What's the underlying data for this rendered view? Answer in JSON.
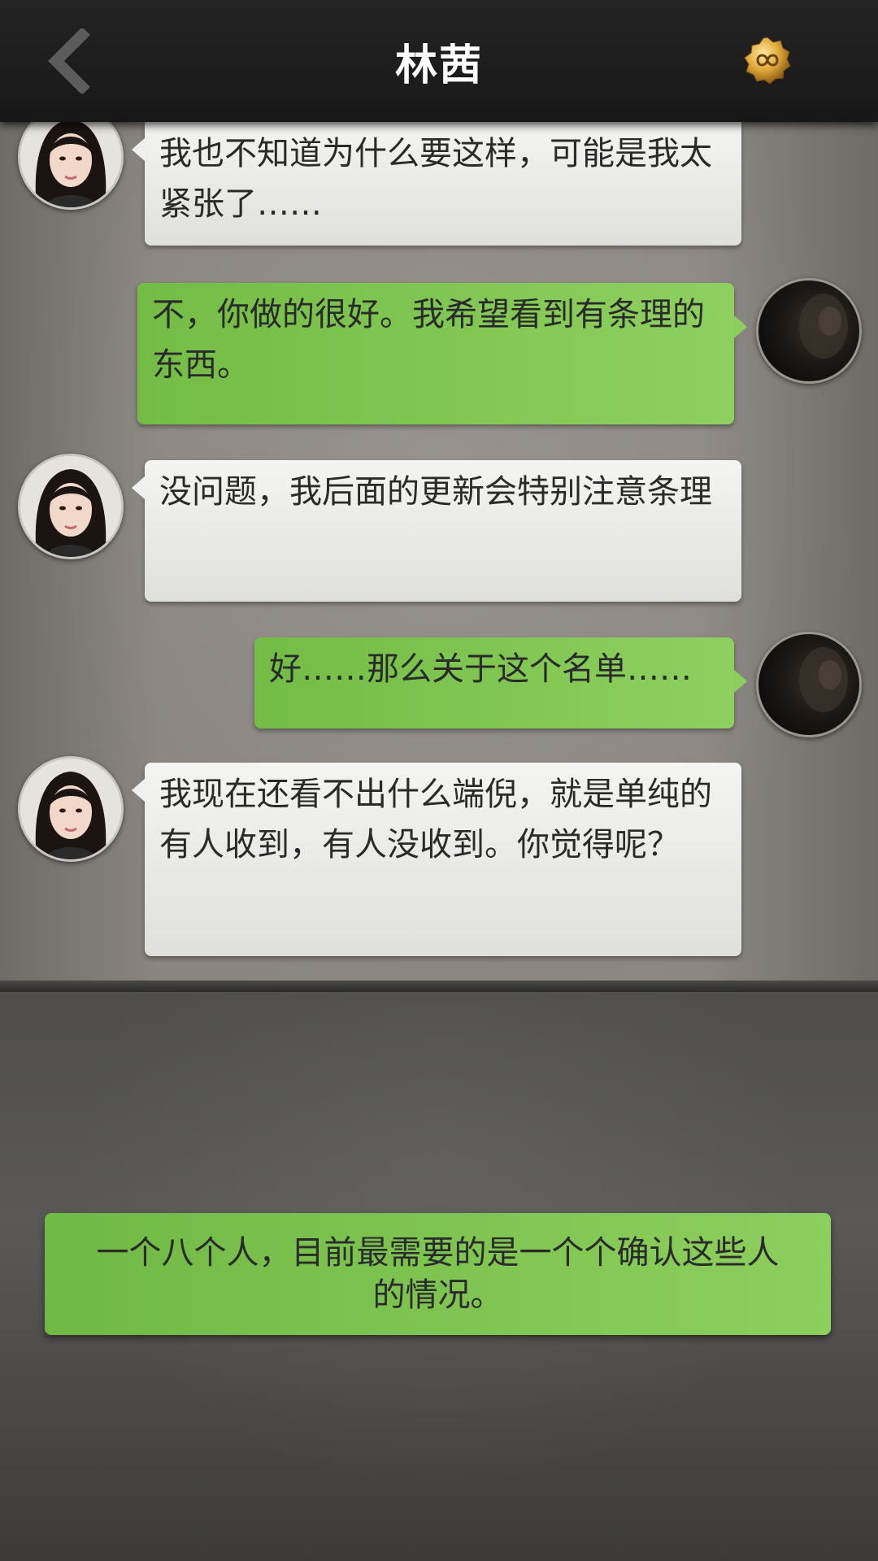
{
  "header": {
    "title": "林茜",
    "back_icon": "chevron-left-icon",
    "coin_icon": "infinity-coin-icon"
  },
  "messages": [
    {
      "side": "left",
      "text": "我也不知道为什么要这样，可能是我太紧张了……"
    },
    {
      "side": "right",
      "text": "不，你做的很好。我希望看到有条理的东西。"
    },
    {
      "side": "left",
      "text": "没问题，我后面的更新会特别注意条理"
    },
    {
      "side": "right",
      "text": "好……那么关于这个名单……"
    },
    {
      "side": "left",
      "text": "我现在还看不出什么端倪，就是单纯的有人收到，有人没收到。你觉得呢？"
    }
  ],
  "choice": {
    "text": "一个八个人，目前最需要的是一个个确认这些人的情况。"
  },
  "colors": {
    "bubble_green": "#7fc452",
    "bubble_gray": "#e8e8e6",
    "header_bg": "#1e1e1e"
  }
}
